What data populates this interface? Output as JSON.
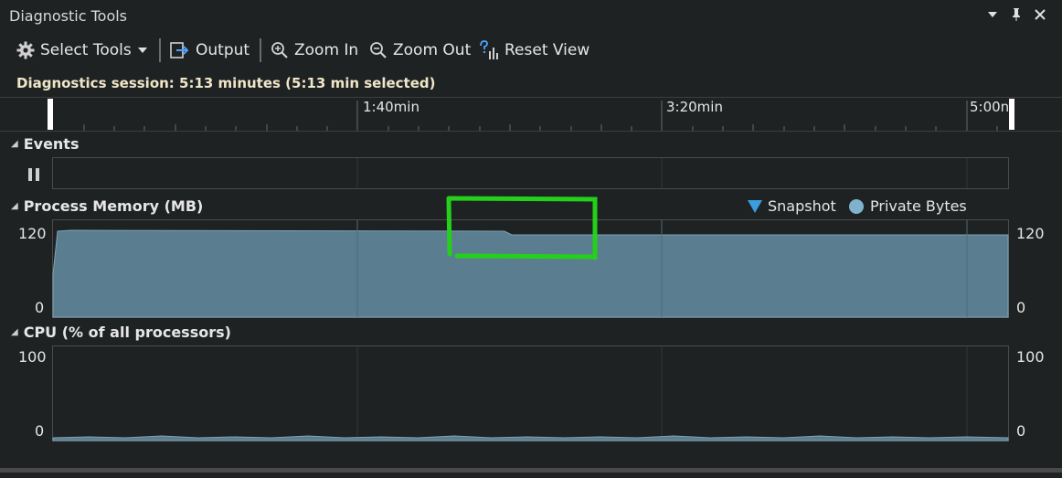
{
  "window": {
    "title": "Diagnostic Tools",
    "controls": {
      "dropdown_glyph": "▾",
      "pin_glyph": "⊓",
      "close_glyph": "✕"
    }
  },
  "toolbar": {
    "select_tools": "Select Tools",
    "output": "Output",
    "zoom_in": "Zoom In",
    "zoom_out": "Zoom Out",
    "reset_view": "Reset View"
  },
  "session": {
    "text": "Diagnostics session: 5:13 minutes (5:13 min selected)"
  },
  "timeline": {
    "labels": [
      "1:40min",
      "3:20min",
      "5:00n"
    ]
  },
  "events": {
    "title": "Events",
    "pause_glyph": "⏸"
  },
  "memory": {
    "title": "Process Memory (MB)",
    "y_max_label": "120",
    "y_min_label": "0",
    "legend": {
      "snapshot": "Snapshot",
      "private_bytes": "Private Bytes"
    }
  },
  "cpu": {
    "title": "CPU (% of all processors)",
    "y_max_label": "100",
    "y_min_label": "0"
  },
  "colors": {
    "area_fill": "#5a7e90",
    "area_line": "#7fa3b5",
    "highlight": "#25d01a",
    "snapshot": "#3b9de0",
    "private_bytes": "#7fb3cc"
  }
}
